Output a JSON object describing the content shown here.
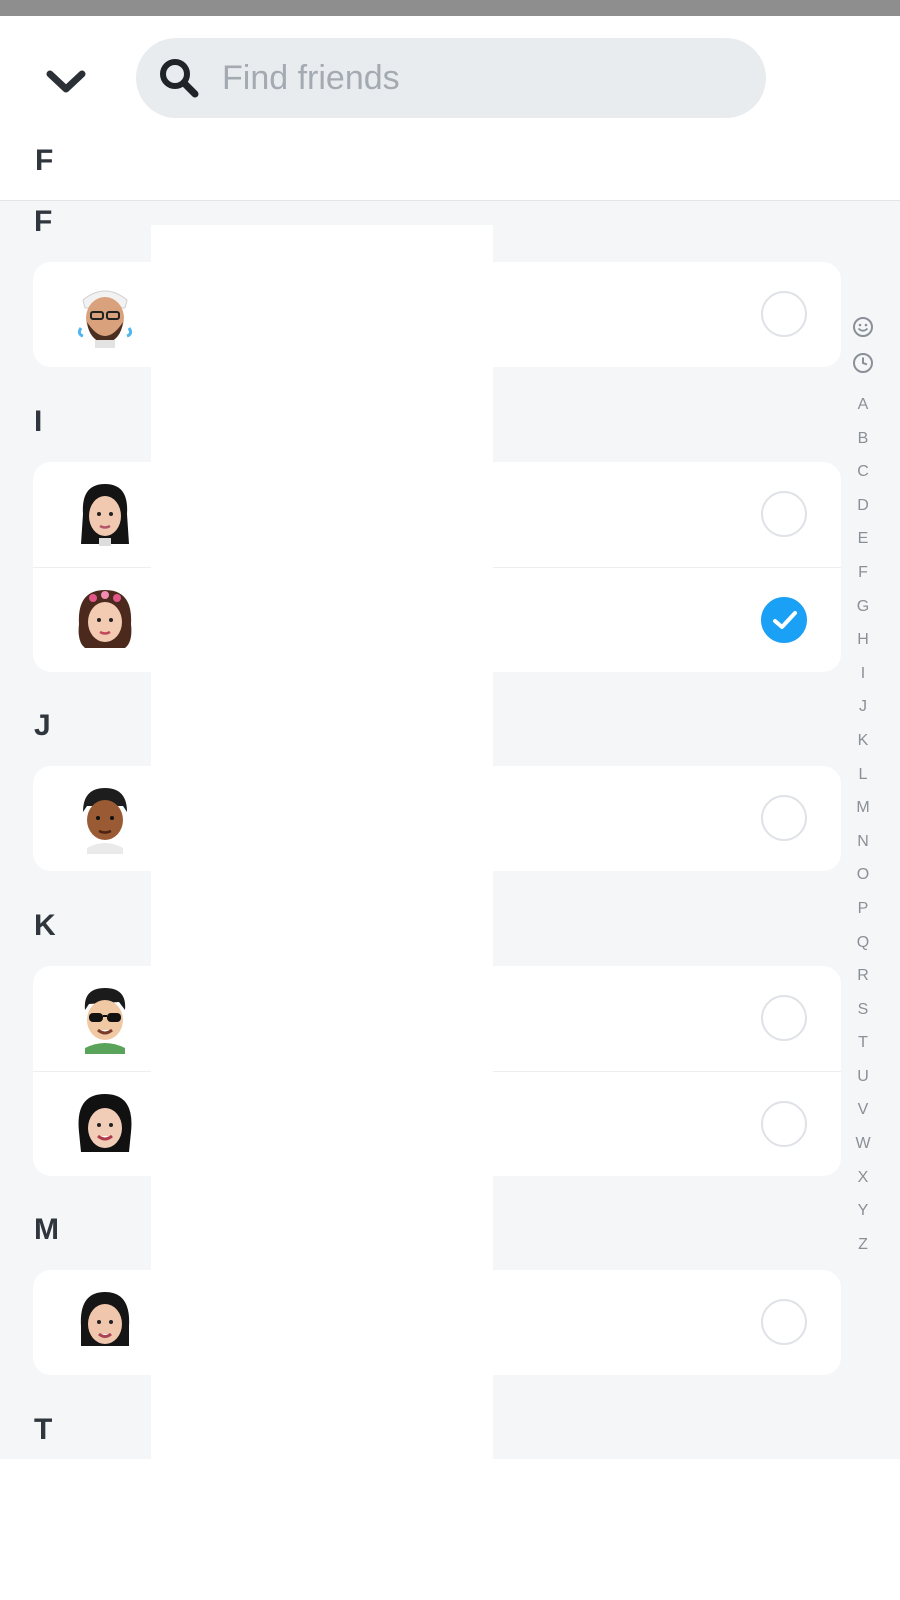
{
  "search": {
    "placeholder": "Find friends"
  },
  "sticky_header": "F",
  "sections": [
    {
      "letter": "F",
      "friends": [
        {
          "avatar": "bitmoji-man-turban-icon",
          "selected": false
        }
      ]
    },
    {
      "letter": "I",
      "friends": [
        {
          "avatar": "bitmoji-woman-dark-hair-icon",
          "selected": false
        },
        {
          "avatar": "bitmoji-woman-flower-crown-icon",
          "selected": true
        }
      ]
    },
    {
      "letter": "J",
      "friends": [
        {
          "avatar": "bitmoji-man-brown-icon",
          "selected": false
        }
      ]
    },
    {
      "letter": "K",
      "friends": [
        {
          "avatar": "bitmoji-man-sunglasses-icon",
          "selected": false
        },
        {
          "avatar": "bitmoji-woman-smiling-icon",
          "selected": false
        }
      ]
    },
    {
      "letter": "M",
      "friends": [
        {
          "avatar": "bitmoji-woman-bob-icon",
          "selected": false
        }
      ]
    },
    {
      "letter": "T",
      "friends": []
    }
  ],
  "index_bar": {
    "icons": [
      "smiley-icon",
      "clock-icon"
    ],
    "letters": [
      "A",
      "B",
      "C",
      "D",
      "E",
      "F",
      "G",
      "H",
      "I",
      "J",
      "K",
      "L",
      "M",
      "N",
      "O",
      "P",
      "Q",
      "R",
      "S",
      "T",
      "U",
      "V",
      "W",
      "X",
      "Y",
      "Z"
    ]
  },
  "colors": {
    "accent": "#1aa0f5",
    "list_background": "#f5f6f8",
    "search_background": "#e9ecef"
  }
}
